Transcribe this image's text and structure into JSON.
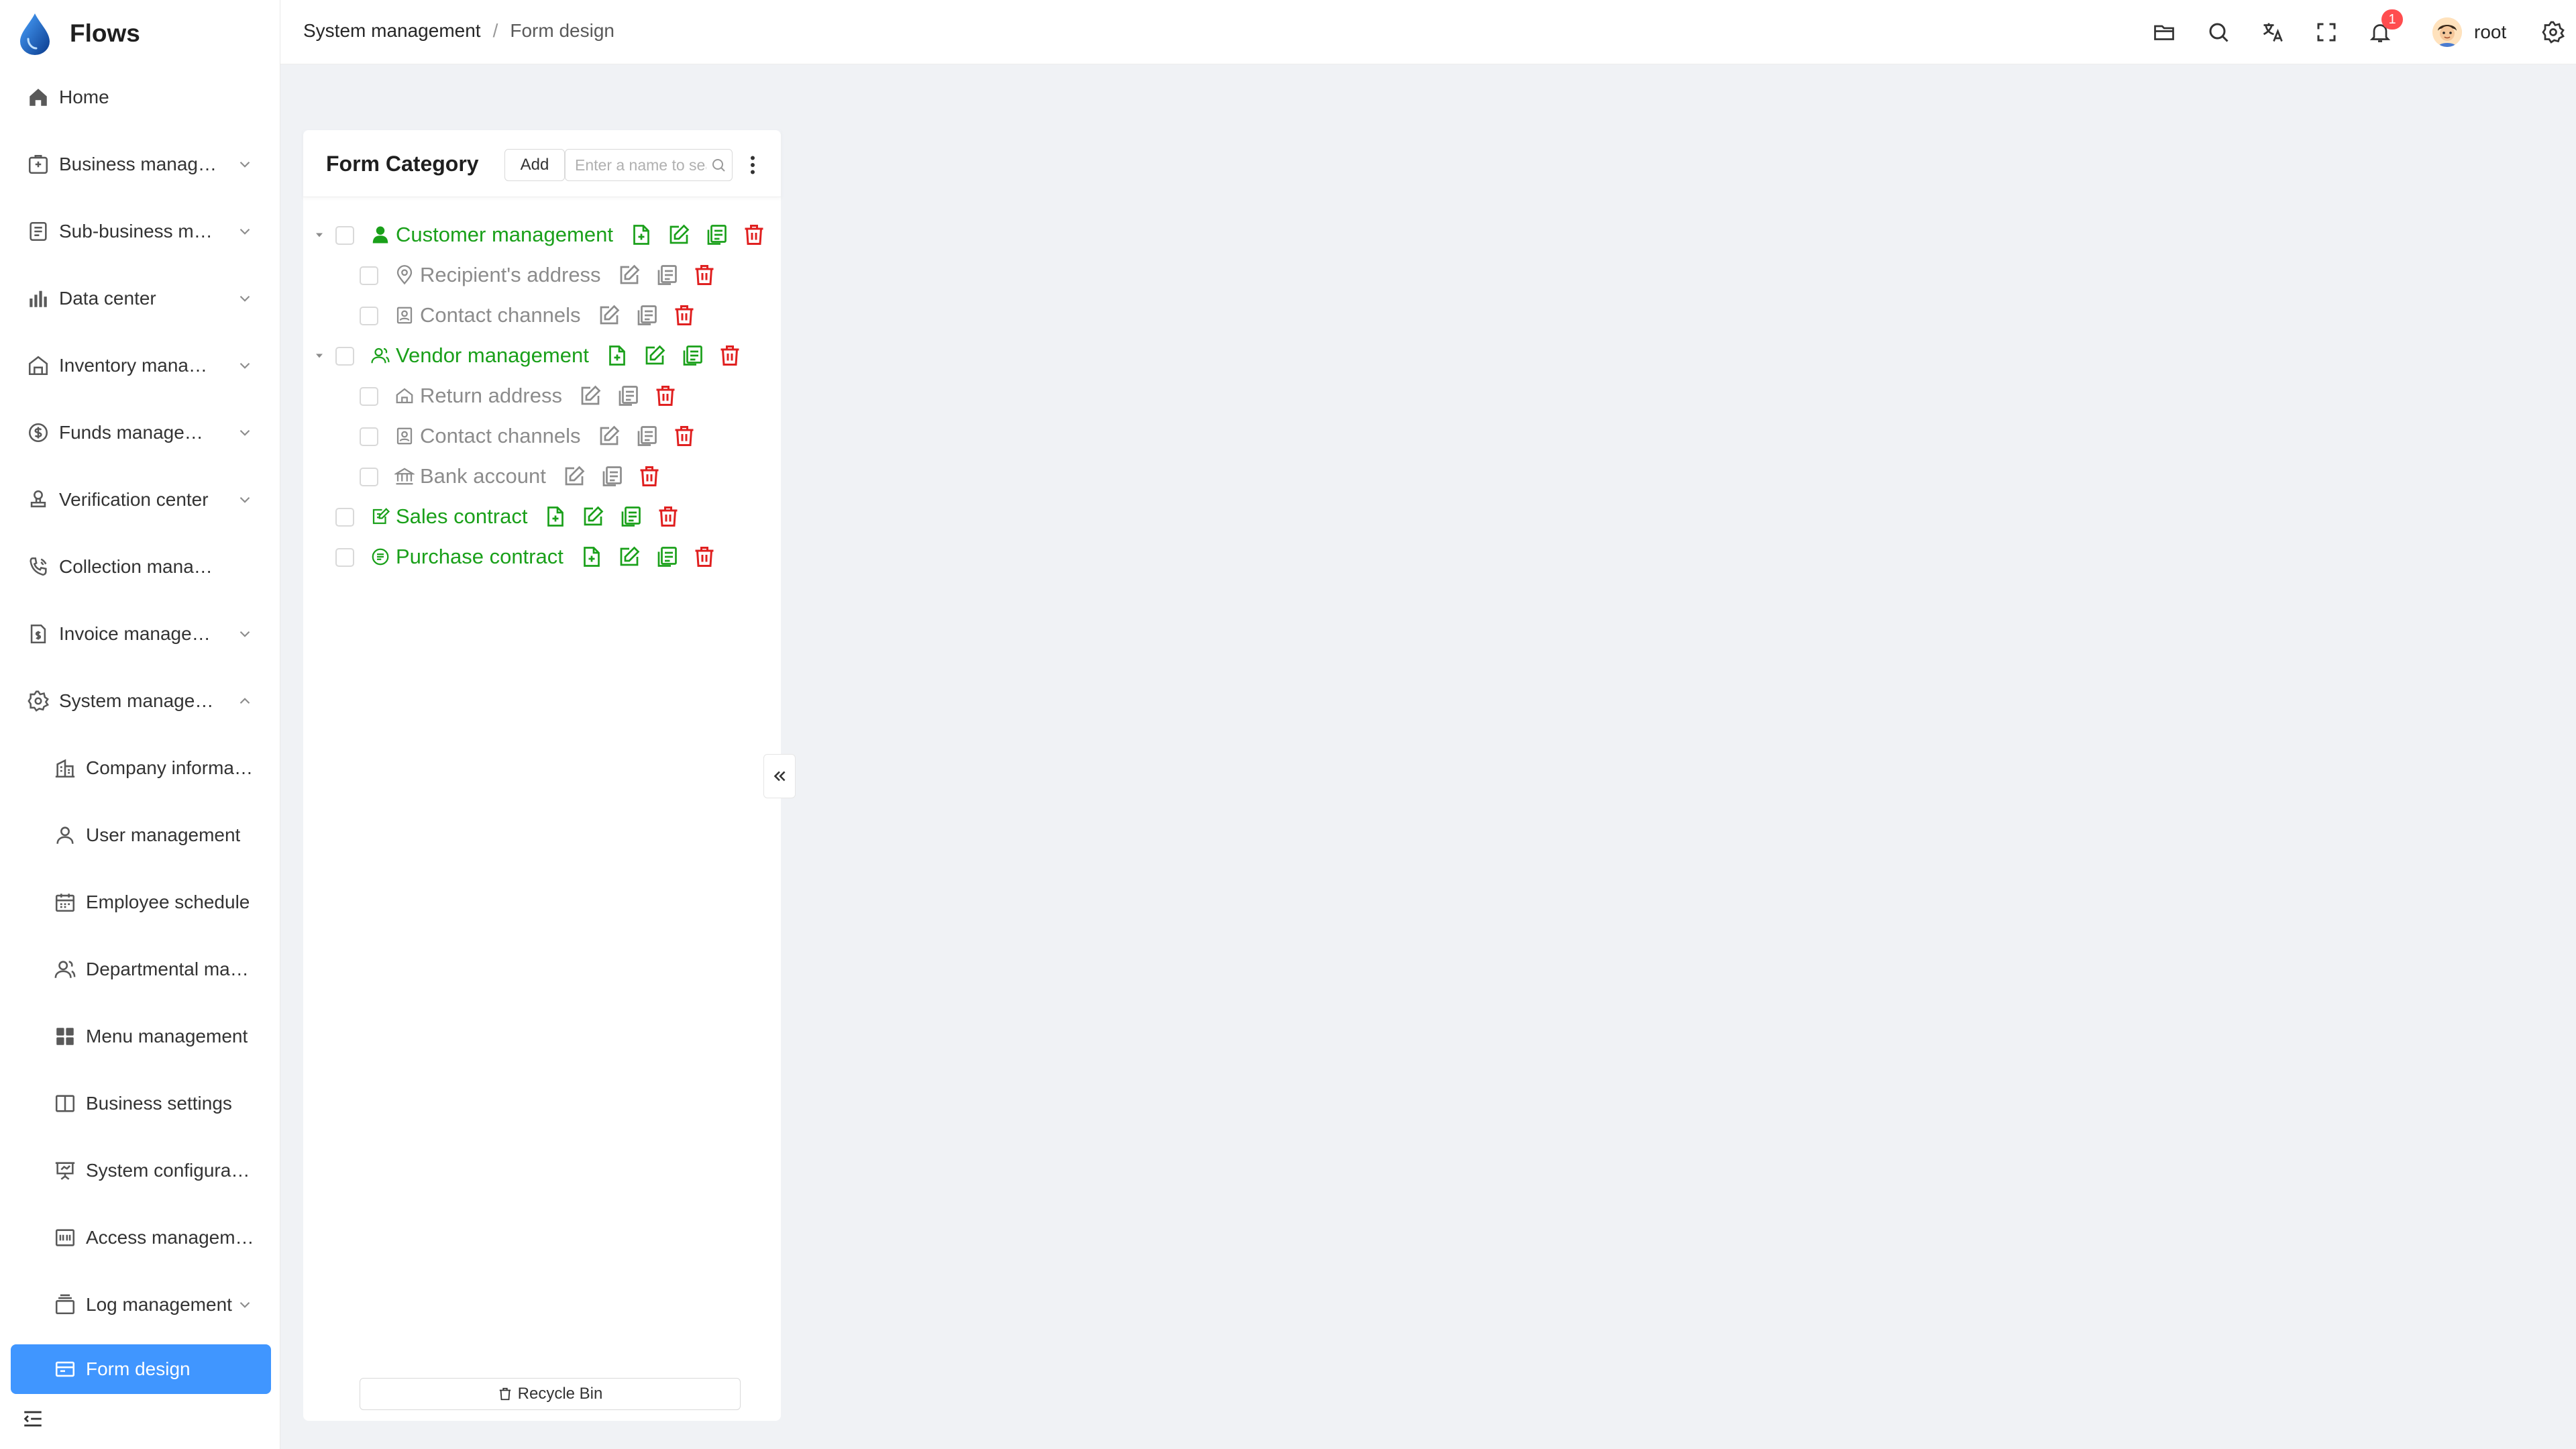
{
  "app": {
    "name": "Flows"
  },
  "sidebar": {
    "items": [
      {
        "label": "Home",
        "icon": "home-icon",
        "expandable": false
      },
      {
        "label": "Business management",
        "icon": "briefcase-icon",
        "expandable": true
      },
      {
        "label": "Sub-business management",
        "icon": "list-icon",
        "expandable": true
      },
      {
        "label": "Data center",
        "icon": "bar-chart-icon",
        "expandable": true
      },
      {
        "label": "Inventory management",
        "icon": "warehouse-icon",
        "expandable": true
      },
      {
        "label": "Funds management",
        "icon": "dollar-icon",
        "expandable": true
      },
      {
        "label": "Verification center",
        "icon": "stamp-icon",
        "expandable": true
      },
      {
        "label": "Collection management",
        "icon": "phone-icon",
        "expandable": false
      },
      {
        "label": "Invoice management",
        "icon": "invoice-icon",
        "expandable": true
      },
      {
        "label": "System management",
        "icon": "gear-icon",
        "expandable": true,
        "expanded": true
      }
    ],
    "sub_items": [
      {
        "label": "Company information",
        "icon": "company-icon"
      },
      {
        "label": "User management",
        "icon": "user-icon"
      },
      {
        "label": "Employee schedule",
        "icon": "calendar-icon"
      },
      {
        "label": "Departmental management",
        "icon": "users-icon"
      },
      {
        "label": "Menu management",
        "icon": "grid-icon"
      },
      {
        "label": "Business settings",
        "icon": "book-icon"
      },
      {
        "label": "System configuration",
        "icon": "presentation-icon"
      },
      {
        "label": "Access management",
        "icon": "access-icon"
      },
      {
        "label": "Log management",
        "icon": "log-icon",
        "expandable": true
      },
      {
        "label": "Form design",
        "icon": "form-icon",
        "active": true
      }
    ]
  },
  "header": {
    "breadcrumb": [
      "System management",
      "Form design"
    ],
    "notifications_count": "1",
    "user_name": "root"
  },
  "panel": {
    "title": "Form Category",
    "add_label": "Add",
    "search_placeholder": "Enter a name to search",
    "recycle_label": "Recycle Bin",
    "tree": [
      {
        "label": "Customer management",
        "level": 0,
        "expanded": true,
        "icon": "user-solid-icon",
        "actions": [
          "add",
          "edit",
          "copy",
          "delete"
        ]
      },
      {
        "label": "Recipient's address",
        "level": 1,
        "icon": "location-user-icon",
        "actions": [
          "edit",
          "copy",
          "delete"
        ]
      },
      {
        "label": "Contact channels",
        "level": 1,
        "icon": "contact-card-icon",
        "actions": [
          "edit",
          "copy",
          "delete"
        ]
      },
      {
        "label": "Vendor management",
        "level": 0,
        "expanded": true,
        "icon": "users-icon",
        "actions": [
          "add",
          "edit",
          "copy",
          "delete"
        ]
      },
      {
        "label": "Return address",
        "level": 1,
        "icon": "home-outline-icon",
        "actions": [
          "edit",
          "copy",
          "delete"
        ]
      },
      {
        "label": "Contact channels",
        "level": 1,
        "icon": "contact-card-icon",
        "actions": [
          "edit",
          "copy",
          "delete"
        ]
      },
      {
        "label": "Bank account",
        "level": 1,
        "icon": "bank-icon",
        "actions": [
          "edit",
          "copy",
          "delete"
        ]
      },
      {
        "label": "Sales contract",
        "level": 0,
        "icon": "contract-edit-icon",
        "actions": [
          "add",
          "edit",
          "copy",
          "delete"
        ]
      },
      {
        "label": "Purchase contract",
        "level": 0,
        "icon": "contract-seal-icon",
        "actions": [
          "add",
          "edit",
          "copy",
          "delete"
        ]
      }
    ]
  },
  "colors": {
    "accent": "#4096ff",
    "green": "#1aa01a",
    "red": "#e02020",
    "grey": "#8c8c8c"
  }
}
